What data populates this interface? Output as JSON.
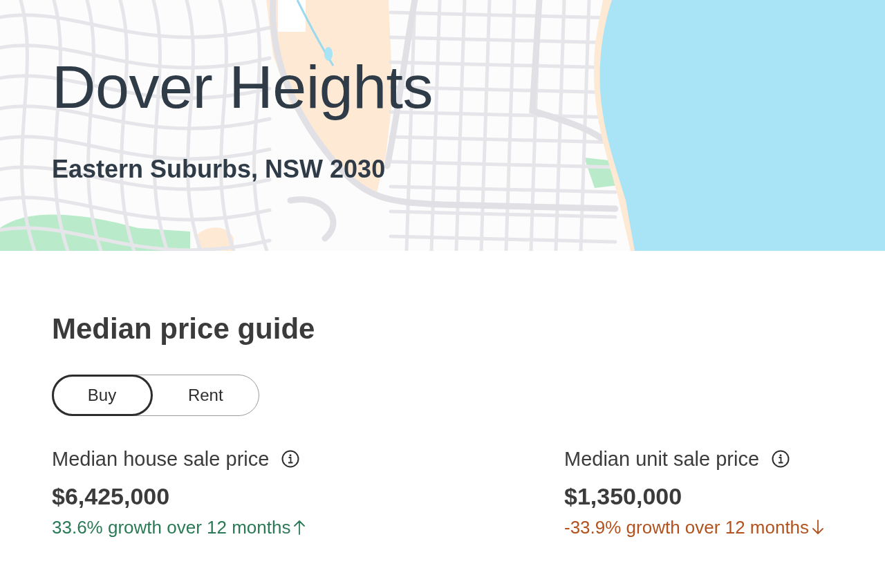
{
  "header": {
    "suburb": "Dover Heights",
    "region": "Eastern Suburbs, NSW 2030"
  },
  "price_guide": {
    "title": "Median price guide",
    "tabs": [
      {
        "label": "Buy",
        "selected": true
      },
      {
        "label": "Rent",
        "selected": false
      }
    ],
    "stats": [
      {
        "kind": "up",
        "label": "Median house sale price",
        "price": "$6,425,000",
        "growth": "33.6% growth over 12 months"
      },
      {
        "kind": "down",
        "label": "Median unit sale price",
        "price": "$1,350,000",
        "growth": "-33.9% growth over 12 months"
      }
    ]
  }
}
